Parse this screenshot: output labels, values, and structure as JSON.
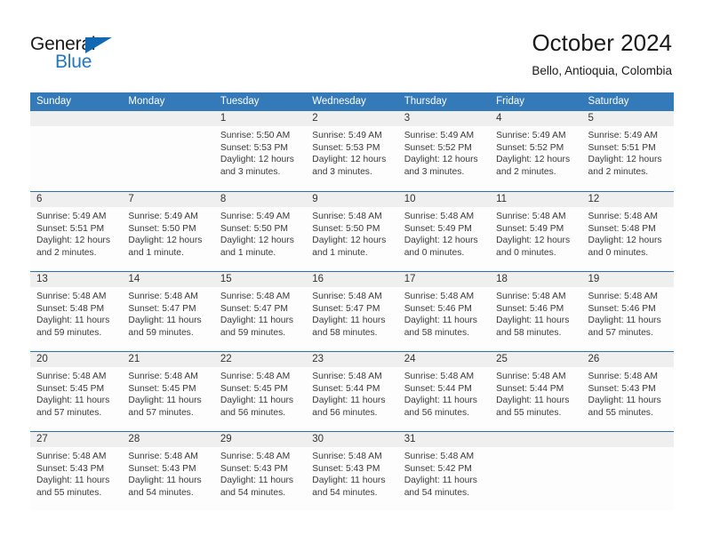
{
  "brand": {
    "name_top": "General",
    "name_bottom": "Blue",
    "accent_color": "#1268b3",
    "blue_text_color": "#2376c4"
  },
  "header": {
    "title": "October 2024",
    "location": "Bello, Antioquia, Colombia"
  },
  "calendar": {
    "header_bg": "#3479b8",
    "daynum_bg": "#efefef",
    "row_divider_color": "#2f6fae",
    "weekdays": [
      "Sunday",
      "Monday",
      "Tuesday",
      "Wednesday",
      "Thursday",
      "Friday",
      "Saturday"
    ],
    "weeks": [
      [
        {
          "day": "",
          "lines": []
        },
        {
          "day": "",
          "lines": []
        },
        {
          "day": "1",
          "lines": [
            "Sunrise: 5:50 AM",
            "Sunset: 5:53 PM",
            "Daylight: 12 hours",
            "and 3 minutes."
          ]
        },
        {
          "day": "2",
          "lines": [
            "Sunrise: 5:49 AM",
            "Sunset: 5:53 PM",
            "Daylight: 12 hours",
            "and 3 minutes."
          ]
        },
        {
          "day": "3",
          "lines": [
            "Sunrise: 5:49 AM",
            "Sunset: 5:52 PM",
            "Daylight: 12 hours",
            "and 3 minutes."
          ]
        },
        {
          "day": "4",
          "lines": [
            "Sunrise: 5:49 AM",
            "Sunset: 5:52 PM",
            "Daylight: 12 hours",
            "and 2 minutes."
          ]
        },
        {
          "day": "5",
          "lines": [
            "Sunrise: 5:49 AM",
            "Sunset: 5:51 PM",
            "Daylight: 12 hours",
            "and 2 minutes."
          ]
        }
      ],
      [
        {
          "day": "6",
          "lines": [
            "Sunrise: 5:49 AM",
            "Sunset: 5:51 PM",
            "Daylight: 12 hours",
            "and 2 minutes."
          ]
        },
        {
          "day": "7",
          "lines": [
            "Sunrise: 5:49 AM",
            "Sunset: 5:50 PM",
            "Daylight: 12 hours",
            "and 1 minute."
          ]
        },
        {
          "day": "8",
          "lines": [
            "Sunrise: 5:49 AM",
            "Sunset: 5:50 PM",
            "Daylight: 12 hours",
            "and 1 minute."
          ]
        },
        {
          "day": "9",
          "lines": [
            "Sunrise: 5:48 AM",
            "Sunset: 5:50 PM",
            "Daylight: 12 hours",
            "and 1 minute."
          ]
        },
        {
          "day": "10",
          "lines": [
            "Sunrise: 5:48 AM",
            "Sunset: 5:49 PM",
            "Daylight: 12 hours",
            "and 0 minutes."
          ]
        },
        {
          "day": "11",
          "lines": [
            "Sunrise: 5:48 AM",
            "Sunset: 5:49 PM",
            "Daylight: 12 hours",
            "and 0 minutes."
          ]
        },
        {
          "day": "12",
          "lines": [
            "Sunrise: 5:48 AM",
            "Sunset: 5:48 PM",
            "Daylight: 12 hours",
            "and 0 minutes."
          ]
        }
      ],
      [
        {
          "day": "13",
          "lines": [
            "Sunrise: 5:48 AM",
            "Sunset: 5:48 PM",
            "Daylight: 11 hours",
            "and 59 minutes."
          ]
        },
        {
          "day": "14",
          "lines": [
            "Sunrise: 5:48 AM",
            "Sunset: 5:47 PM",
            "Daylight: 11 hours",
            "and 59 minutes."
          ]
        },
        {
          "day": "15",
          "lines": [
            "Sunrise: 5:48 AM",
            "Sunset: 5:47 PM",
            "Daylight: 11 hours",
            "and 59 minutes."
          ]
        },
        {
          "day": "16",
          "lines": [
            "Sunrise: 5:48 AM",
            "Sunset: 5:47 PM",
            "Daylight: 11 hours",
            "and 58 minutes."
          ]
        },
        {
          "day": "17",
          "lines": [
            "Sunrise: 5:48 AM",
            "Sunset: 5:46 PM",
            "Daylight: 11 hours",
            "and 58 minutes."
          ]
        },
        {
          "day": "18",
          "lines": [
            "Sunrise: 5:48 AM",
            "Sunset: 5:46 PM",
            "Daylight: 11 hours",
            "and 58 minutes."
          ]
        },
        {
          "day": "19",
          "lines": [
            "Sunrise: 5:48 AM",
            "Sunset: 5:46 PM",
            "Daylight: 11 hours",
            "and 57 minutes."
          ]
        }
      ],
      [
        {
          "day": "20",
          "lines": [
            "Sunrise: 5:48 AM",
            "Sunset: 5:45 PM",
            "Daylight: 11 hours",
            "and 57 minutes."
          ]
        },
        {
          "day": "21",
          "lines": [
            "Sunrise: 5:48 AM",
            "Sunset: 5:45 PM",
            "Daylight: 11 hours",
            "and 57 minutes."
          ]
        },
        {
          "day": "22",
          "lines": [
            "Sunrise: 5:48 AM",
            "Sunset: 5:45 PM",
            "Daylight: 11 hours",
            "and 56 minutes."
          ]
        },
        {
          "day": "23",
          "lines": [
            "Sunrise: 5:48 AM",
            "Sunset: 5:44 PM",
            "Daylight: 11 hours",
            "and 56 minutes."
          ]
        },
        {
          "day": "24",
          "lines": [
            "Sunrise: 5:48 AM",
            "Sunset: 5:44 PM",
            "Daylight: 11 hours",
            "and 56 minutes."
          ]
        },
        {
          "day": "25",
          "lines": [
            "Sunrise: 5:48 AM",
            "Sunset: 5:44 PM",
            "Daylight: 11 hours",
            "and 55 minutes."
          ]
        },
        {
          "day": "26",
          "lines": [
            "Sunrise: 5:48 AM",
            "Sunset: 5:43 PM",
            "Daylight: 11 hours",
            "and 55 minutes."
          ]
        }
      ],
      [
        {
          "day": "27",
          "lines": [
            "Sunrise: 5:48 AM",
            "Sunset: 5:43 PM",
            "Daylight: 11 hours",
            "and 55 minutes."
          ]
        },
        {
          "day": "28",
          "lines": [
            "Sunrise: 5:48 AM",
            "Sunset: 5:43 PM",
            "Daylight: 11 hours",
            "and 54 minutes."
          ]
        },
        {
          "day": "29",
          "lines": [
            "Sunrise: 5:48 AM",
            "Sunset: 5:43 PM",
            "Daylight: 11 hours",
            "and 54 minutes."
          ]
        },
        {
          "day": "30",
          "lines": [
            "Sunrise: 5:48 AM",
            "Sunset: 5:43 PM",
            "Daylight: 11 hours",
            "and 54 minutes."
          ]
        },
        {
          "day": "31",
          "lines": [
            "Sunrise: 5:48 AM",
            "Sunset: 5:42 PM",
            "Daylight: 11 hours",
            "and 54 minutes."
          ]
        },
        {
          "day": "",
          "lines": []
        },
        {
          "day": "",
          "lines": []
        }
      ]
    ]
  }
}
